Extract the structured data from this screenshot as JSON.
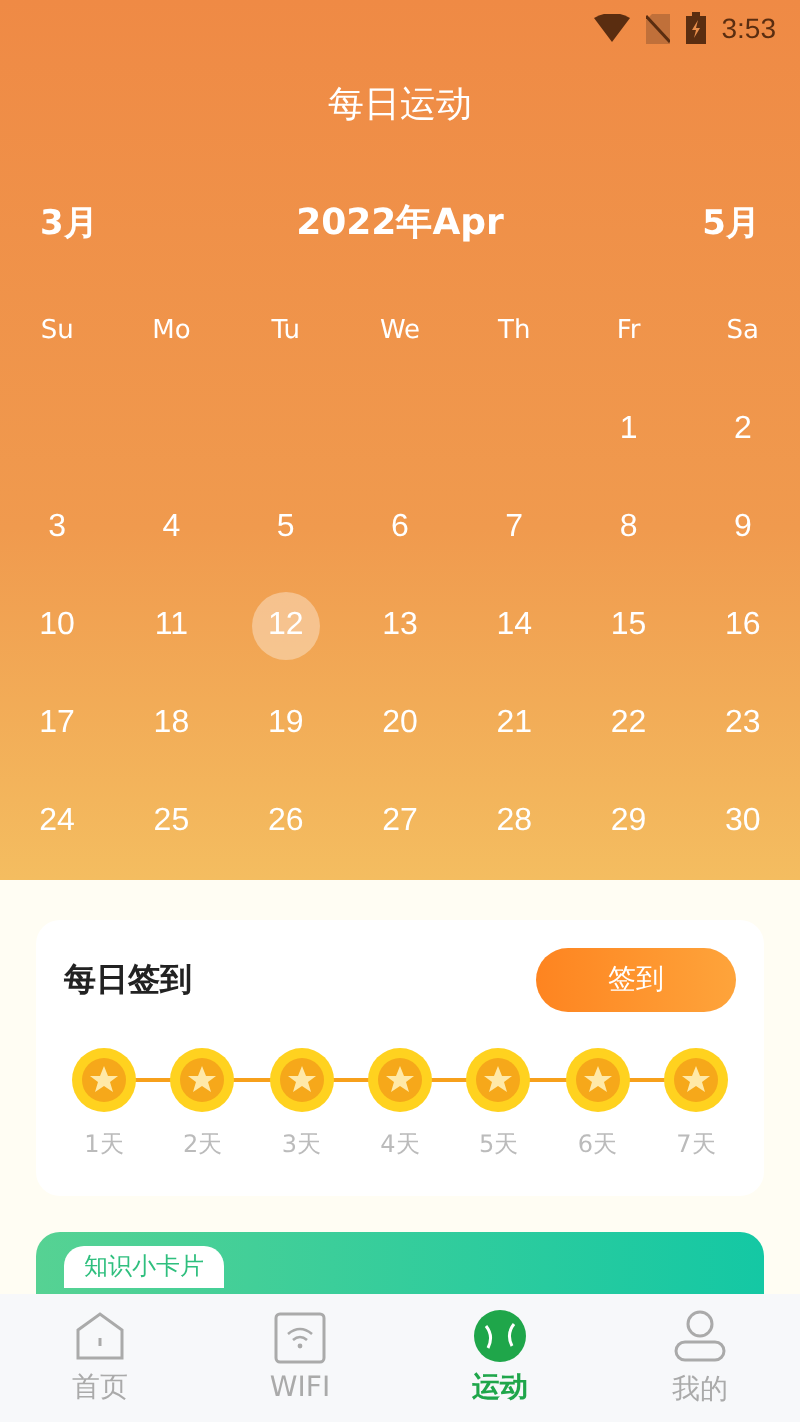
{
  "status_bar": {
    "time": "3:53"
  },
  "title": "每日运动",
  "calendar": {
    "prev": "3月",
    "current": "2022年Apr",
    "next": "5月",
    "weekdays": [
      "Su",
      "Mo",
      "Tu",
      "We",
      "Th",
      "Fr",
      "Sa"
    ],
    "weeks": [
      [
        {
          "day": "1",
          "selected": false
        },
        {
          "day": "2",
          "selected": false
        }
      ],
      [
        {
          "day": "3",
          "selected": false
        },
        {
          "day": "4",
          "selected": false
        },
        {
          "day": "5",
          "selected": false
        },
        {
          "day": "6",
          "selected": false
        },
        {
          "day": "7",
          "selected": false
        },
        {
          "day": "8",
          "selected": false
        },
        {
          "day": "9",
          "selected": false
        }
      ],
      [
        {
          "day": "10",
          "selected": false
        },
        {
          "day": "11",
          "selected": false
        },
        {
          "day": "12",
          "selected": true
        },
        {
          "day": "13",
          "selected": false
        },
        {
          "day": "14",
          "selected": false
        },
        {
          "day": "15",
          "selected": false
        },
        {
          "day": "16",
          "selected": false
        }
      ],
      [
        {
          "day": "17",
          "selected": false
        },
        {
          "day": "18",
          "selected": false
        },
        {
          "day": "19",
          "selected": false
        },
        {
          "day": "20",
          "selected": false
        },
        {
          "day": "21",
          "selected": false
        },
        {
          "day": "22",
          "selected": false
        },
        {
          "day": "23",
          "selected": false
        }
      ],
      [
        {
          "day": "24",
          "selected": false
        },
        {
          "day": "25",
          "selected": false
        },
        {
          "day": "26",
          "selected": false
        },
        {
          "day": "27",
          "selected": false
        },
        {
          "day": "28",
          "selected": false
        },
        {
          "day": "29",
          "selected": false
        },
        {
          "day": "30",
          "selected": false
        }
      ]
    ]
  },
  "checkin": {
    "title": "每日签到",
    "button": "签到",
    "days": [
      "1天",
      "2天",
      "3天",
      "4天",
      "5天",
      "6天",
      "7天"
    ]
  },
  "knowledge_card": {
    "tag": "知识小卡片"
  },
  "nav": [
    {
      "label": "首页",
      "kind": "home",
      "selected": false
    },
    {
      "label": "WIFI",
      "kind": "wifi",
      "selected": false
    },
    {
      "label": "运动",
      "kind": "sport",
      "selected": true
    },
    {
      "label": "我的",
      "kind": "me",
      "selected": false
    }
  ]
}
